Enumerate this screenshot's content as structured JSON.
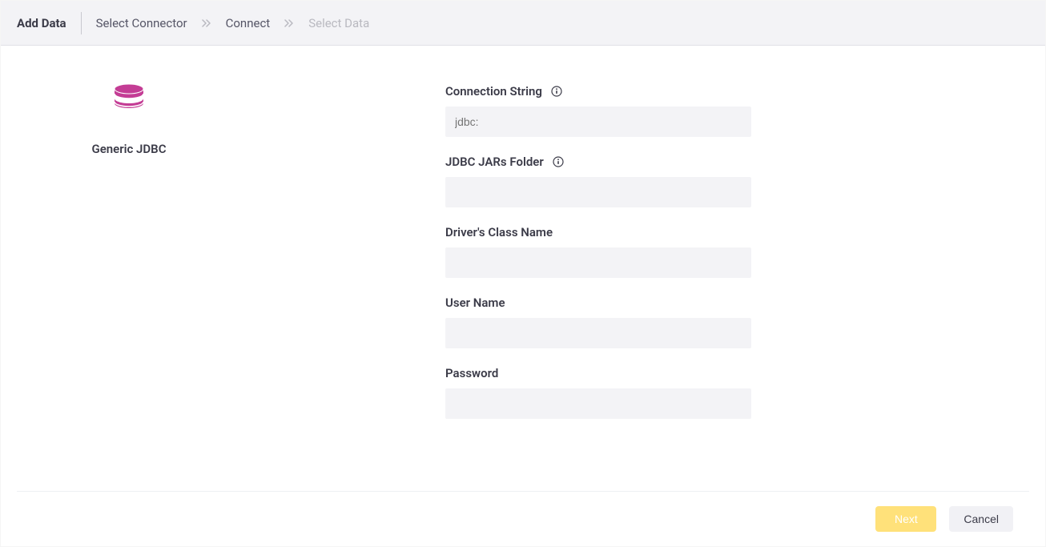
{
  "header": {
    "title": "Add Data",
    "steps": [
      {
        "label": "Select Connector",
        "active": true
      },
      {
        "label": "Connect",
        "active": true
      },
      {
        "label": "Select Data",
        "active": false
      }
    ]
  },
  "connector": {
    "name": "Generic JDBC",
    "icon_color": "#C43D95"
  },
  "form": {
    "connection_string": {
      "label": "Connection String",
      "placeholder": "jdbc:",
      "value": ""
    },
    "jars_folder": {
      "label": "JDBC JARs Folder",
      "placeholder": "",
      "value": ""
    },
    "driver_class": {
      "label": "Driver's Class Name",
      "placeholder": "",
      "value": ""
    },
    "username": {
      "label": "User Name",
      "placeholder": "",
      "value": ""
    },
    "password": {
      "label": "Password",
      "placeholder": "",
      "value": ""
    }
  },
  "footer": {
    "next_label": "Next",
    "cancel_label": "Cancel"
  }
}
